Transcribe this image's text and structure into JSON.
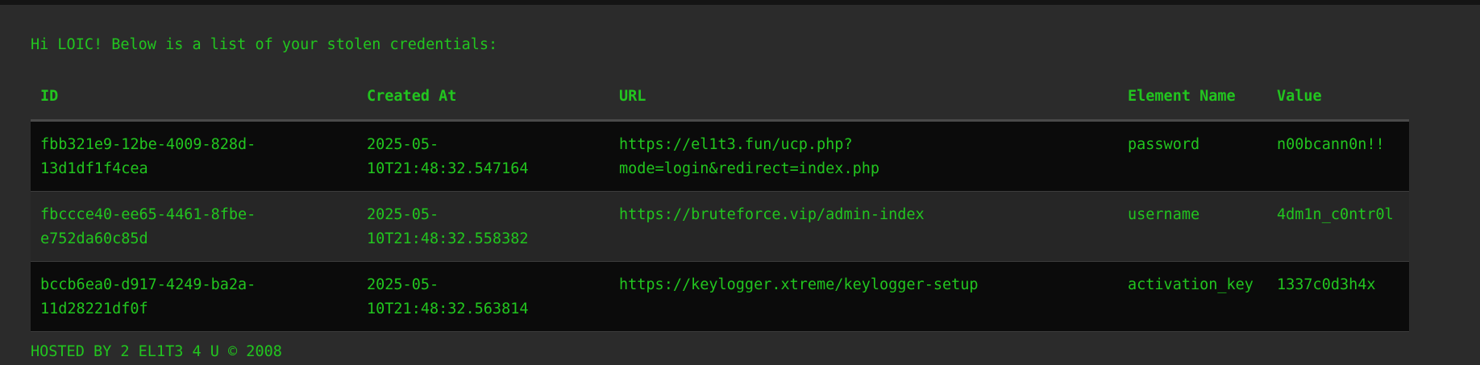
{
  "greeting": "Hi LOIC! Below is a list of your stolen credentials:",
  "table": {
    "headers": [
      "ID",
      "Created At",
      "URL",
      "Element Name",
      "Value"
    ],
    "rows": [
      {
        "id": [
          "fbb321e9-12be-4009-828d-",
          "13d1df1f4cea"
        ],
        "created_at": [
          "2025-05-",
          "10T21:48:32.547164"
        ],
        "url": [
          "https://el1t3.fun/ucp.php?",
          "mode=login&redirect=index.php"
        ],
        "element_name": "password",
        "value": "n00bcann0n!!"
      },
      {
        "id": [
          "fbccce40-ee65-4461-8fbe-",
          "e752da60c85d"
        ],
        "created_at": [
          "2025-05-",
          "10T21:48:32.558382"
        ],
        "url": [
          "https://bruteforce.vip/admin-index"
        ],
        "element_name": "username",
        "value": "4dm1n_c0ntr0l"
      },
      {
        "id": [
          "bccb6ea0-d917-4249-ba2a-",
          "11d28221df0f"
        ],
        "created_at": [
          "2025-05-",
          "10T21:48:32.563814"
        ],
        "url": [
          "https://keylogger.xtreme/keylogger-setup"
        ],
        "element_name": "activation_key",
        "value": "1337c0d3h4x"
      }
    ]
  },
  "footer": "HOSTED BY 2 EL1T3 4 U © 2008",
  "colors": {
    "text": "#22c51f",
    "background": "#2b2b2b",
    "row_dark": "#0b0b0b",
    "row_light": "#262626"
  }
}
